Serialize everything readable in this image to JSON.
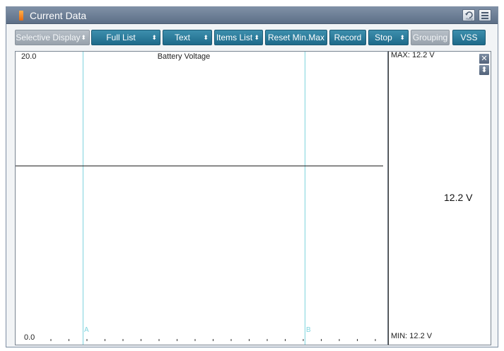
{
  "window": {
    "title": "Current Data"
  },
  "titlebar": {
    "retry_label": "Retry",
    "retry_icon": "retry-icon",
    "menu_icon": "menu-icon"
  },
  "toolbar": {
    "buttons": [
      {
        "label": "Selective Display",
        "dropdown": true,
        "style": "gray"
      },
      {
        "label": "Full List",
        "dropdown": true,
        "style": "teal"
      },
      {
        "label": "Text",
        "dropdown": true,
        "style": "teal"
      },
      {
        "label": "Items List",
        "dropdown": true,
        "style": "teal"
      },
      {
        "label": "Reset Min.Max",
        "dropdown": false,
        "style": "teal"
      },
      {
        "label": "Record",
        "dropdown": false,
        "style": "teal"
      },
      {
        "label": "Stop",
        "dropdown": true,
        "style": "teal"
      },
      {
        "label": "Grouping",
        "dropdown": false,
        "style": "gray"
      },
      {
        "label": "VSS",
        "dropdown": false,
        "style": "teal"
      }
    ]
  },
  "graph": {
    "title": "Battery Voltage",
    "y_max": "20.0",
    "y_min": "0.0",
    "cursor_a": "A",
    "cursor_b": "B",
    "value_fraction": 0.61
  },
  "side_panel": {
    "max_label": "MAX:  12.2 V",
    "current_value": "12.2 V",
    "min_label": "MIN:  12.2 V",
    "close_icon": "close-icon",
    "resize_icon": "resize-icon"
  },
  "colors": {
    "toolbar_button": "#2a7c9c",
    "cursor_line": "#7fd4de",
    "title_bar": "#6d7f96"
  }
}
